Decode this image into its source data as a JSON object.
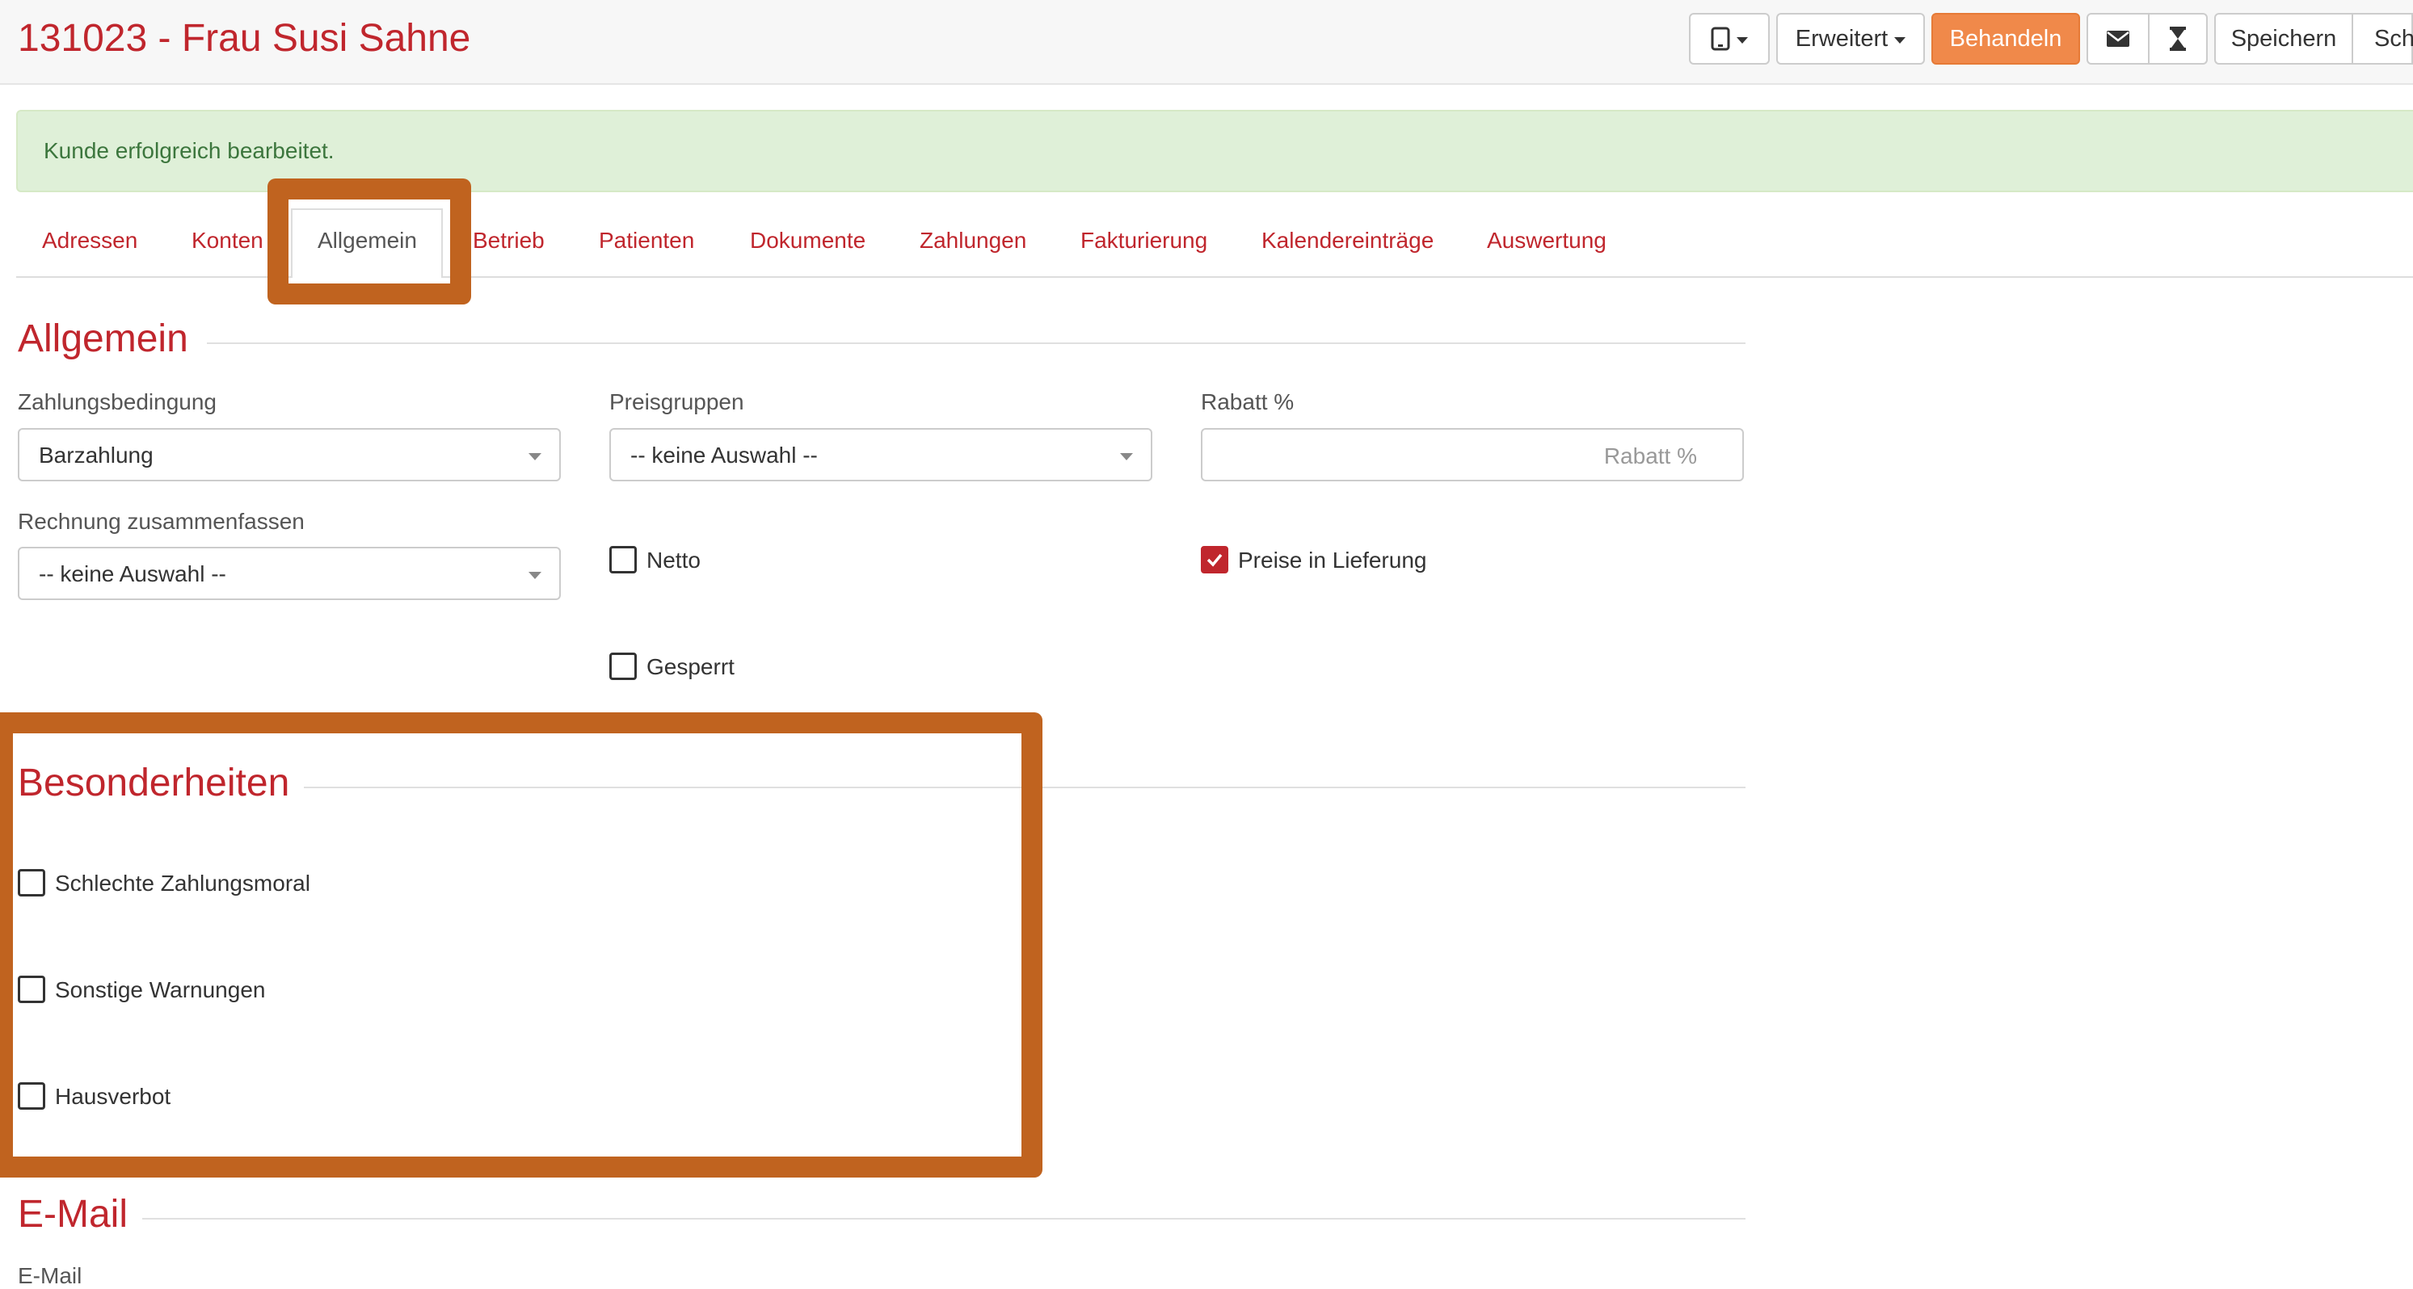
{
  "header": {
    "title": "131023 - Frau Susi Sahne",
    "buttons": {
      "erweitert": "Erweitert",
      "behandeln": "Behandeln",
      "speichern": "Speichern",
      "sch": "Sch"
    },
    "icons": [
      "tablet-icon",
      "envelope-icon",
      "hourglass-icon"
    ],
    "accent_color": "#f0894a"
  },
  "alert": {
    "text": "Kunde erfolgreich bearbeitet."
  },
  "tabs": [
    {
      "label": "Adressen"
    },
    {
      "label": "Konten"
    },
    {
      "label": "Allgemein",
      "active": true
    },
    {
      "label": "Betrieb"
    },
    {
      "label": "Patienten"
    },
    {
      "label": "Dokumente"
    },
    {
      "label": "Zahlungen"
    },
    {
      "label": "Fakturierung"
    },
    {
      "label": "Kalendereinträge"
    },
    {
      "label": "Auswertung"
    }
  ],
  "allgemein": {
    "title": "Allgemein",
    "zahlungsbedingung": {
      "label": "Zahlungsbedingung",
      "value": "Barzahlung"
    },
    "preisgruppen": {
      "label": "Preisgruppen",
      "value": "-- keine Auswahl --"
    },
    "rabatt": {
      "label": "Rabatt %",
      "placeholder": "Rabatt %"
    },
    "rechnung": {
      "label": "Rechnung zusammenfassen",
      "value": "-- keine Auswahl --"
    },
    "netto": {
      "label": "Netto",
      "checked": false
    },
    "preise_in_lieferung": {
      "label": "Preise in Lieferung",
      "checked": true
    },
    "gesperrt": {
      "label": "Gesperrt",
      "checked": false
    }
  },
  "besonderheiten": {
    "title": "Besonderheiten",
    "schlechte_zahlungsmoral": {
      "label": "Schlechte Zahlungsmoral",
      "checked": false
    },
    "sonstige_warnungen": {
      "label": "Sonstige Warnungen",
      "checked": false
    },
    "hausverbot": {
      "label": "Hausverbot",
      "checked": false
    }
  },
  "email": {
    "title": "E-Mail",
    "label": "E-Mail"
  },
  "colors": {
    "brand_red": "#c0262d",
    "highlight": "#c0631f",
    "alert_bg": "#dff0d8"
  }
}
